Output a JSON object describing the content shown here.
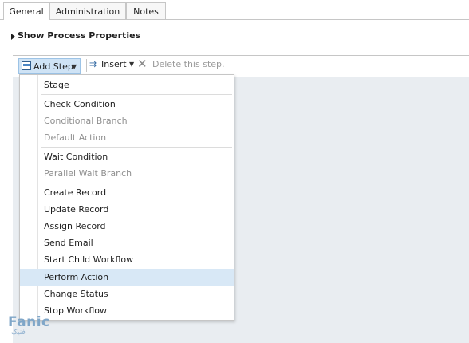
{
  "tabs": [
    {
      "label": "General"
    },
    {
      "label": "Administration"
    },
    {
      "label": "Notes"
    }
  ],
  "section": {
    "title": "Show Process Properties"
  },
  "toolbar": {
    "add_step_label": "Add Step",
    "insert_label": "Insert",
    "delete_label": "Delete this step."
  },
  "menu": {
    "items": [
      {
        "label": "Stage",
        "enabled": true
      },
      {
        "label": "Check Condition",
        "enabled": true
      },
      {
        "label": "Conditional Branch",
        "enabled": false
      },
      {
        "label": "Default Action",
        "enabled": false
      },
      {
        "label": "Wait Condition",
        "enabled": true
      },
      {
        "label": "Parallel Wait Branch",
        "enabled": false
      },
      {
        "label": "Create Record",
        "enabled": true
      },
      {
        "label": "Update Record",
        "enabled": true
      },
      {
        "label": "Assign Record",
        "enabled": true
      },
      {
        "label": "Send Email",
        "enabled": true
      },
      {
        "label": "Start Child Workflow",
        "enabled": true
      },
      {
        "label": "Perform Action",
        "enabled": true,
        "highlighted": true
      },
      {
        "label": "Change Status",
        "enabled": true
      },
      {
        "label": "Stop Workflow",
        "enabled": true
      }
    ]
  },
  "watermark": {
    "text": "Fanic",
    "subtext": "فنیک"
  },
  "colors": {
    "menu_highlight": "#d8e8f6",
    "canvas": "#e9edf1",
    "button_active": "#cfe3f5"
  }
}
